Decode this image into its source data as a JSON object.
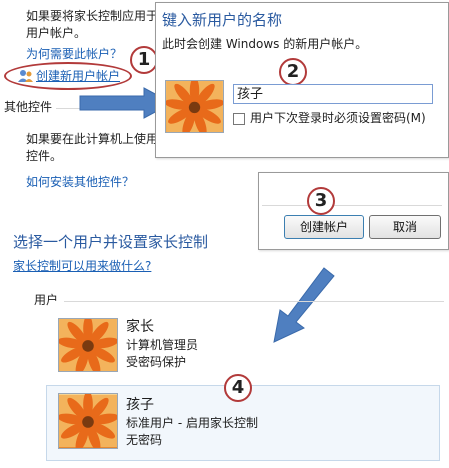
{
  "top_left": {
    "intro_line1": "如果要将家长控制应用于",
    "intro_line2": "用户帐户。",
    "why_link": "为何需要此帐户？",
    "create_link": "创建新用户帐户",
    "other_controls": "其他控件",
    "other_line1": "如果要在此计算机上使用",
    "other_line2": "控件。",
    "install_link": "如何安装其他控件？"
  },
  "dialog": {
    "title": "键入新用户的名称",
    "subtitle": "此时会创建 Windows 的新用户帐户。",
    "name_value": "孩子",
    "checkbox_label": "用户下次登录时必须设置密码(M)"
  },
  "buttons": {
    "create": "创建帐户",
    "cancel": "取消"
  },
  "section": {
    "heading": "选择一个用户并设置家长控制",
    "what_link": "家长控制可以用来做什么?",
    "users_label": "用户"
  },
  "users": [
    {
      "name": "家长",
      "role": "计算机管理员",
      "password": "受密码保护"
    },
    {
      "name": "孩子",
      "role": "标准用户 - 启用家长控制",
      "password": "无密码"
    }
  ],
  "steps": [
    "1",
    "2",
    "3",
    "4"
  ],
  "colors": {
    "link": "#1a5fb4",
    "heading": "#2a5aa0",
    "arrow": "#4f7fc0",
    "step_ring": "#b23a3a"
  }
}
